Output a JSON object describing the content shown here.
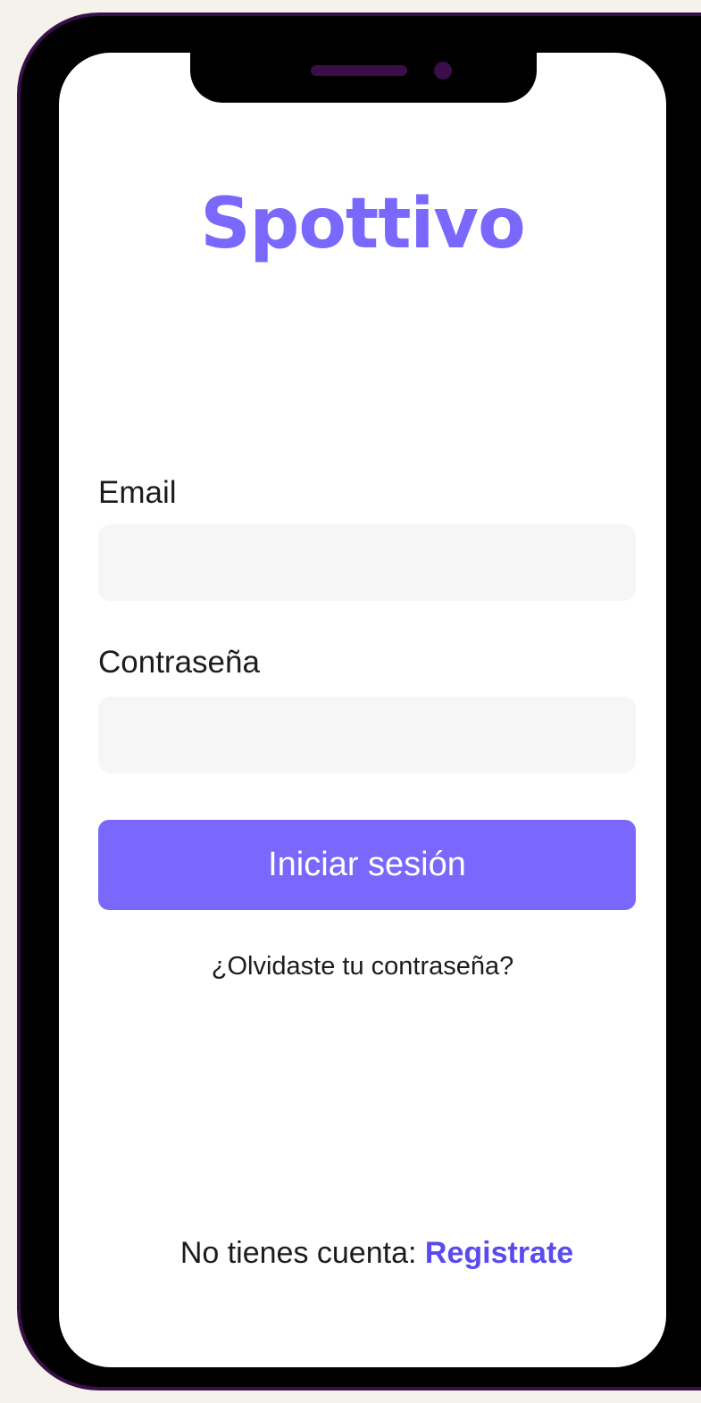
{
  "app": {
    "logo_text": "Spottivo"
  },
  "login_form": {
    "email_label": "Email",
    "email_value": "",
    "password_label": "Contraseña",
    "password_value": "",
    "submit_label": "Iniciar sesión",
    "forgot_password_label": "¿Olvidaste tu contraseña?"
  },
  "signup": {
    "prompt": "No tienes cuenta:",
    "link_label": "Registrate"
  },
  "colors": {
    "accent": "#7a67fb",
    "link": "#5a4af0",
    "frame_border": "#3a0e48",
    "background": "#f5f2ec",
    "input_background": "#f6f6f6"
  }
}
